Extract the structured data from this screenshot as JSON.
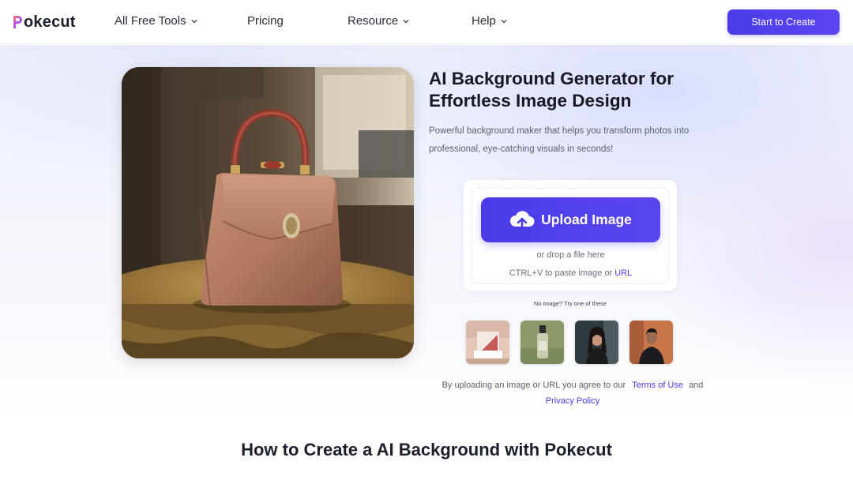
{
  "header": {
    "logo_text": "okecut",
    "logo_initial": "P",
    "nav": [
      {
        "label": "All Free Tools",
        "has_dropdown": true
      },
      {
        "label": "Pricing",
        "has_dropdown": false
      },
      {
        "label": "Resource",
        "has_dropdown": true
      },
      {
        "label": "Help",
        "has_dropdown": true
      }
    ],
    "cta_label": "Start to Create"
  },
  "hero": {
    "title": "AI Background Generator for Effortless Image Design",
    "subtitle": "Powerful background maker that helps you transform photos into professional, eye-catching visuals in seconds!",
    "upload_label": "Upload Image",
    "drop_text": "or drop a file here",
    "paste_text": "CTRL+V to paste image or",
    "url_link": "URL",
    "no_image_text": "No image? Try one of these",
    "samples": [
      "sample-room",
      "sample-bottle",
      "sample-woman",
      "sample-man"
    ],
    "terms_prefix": "By uploading an image or URL you agree to our",
    "terms_link": "Terms of Use",
    "terms_and": "and",
    "privacy_link": "Privacy Policy"
  },
  "howto_title": "How to Create a AI Background with Pokecut",
  "colors": {
    "accent": "#4a3ce8",
    "text": "#1f2430",
    "muted": "#5b606c"
  }
}
